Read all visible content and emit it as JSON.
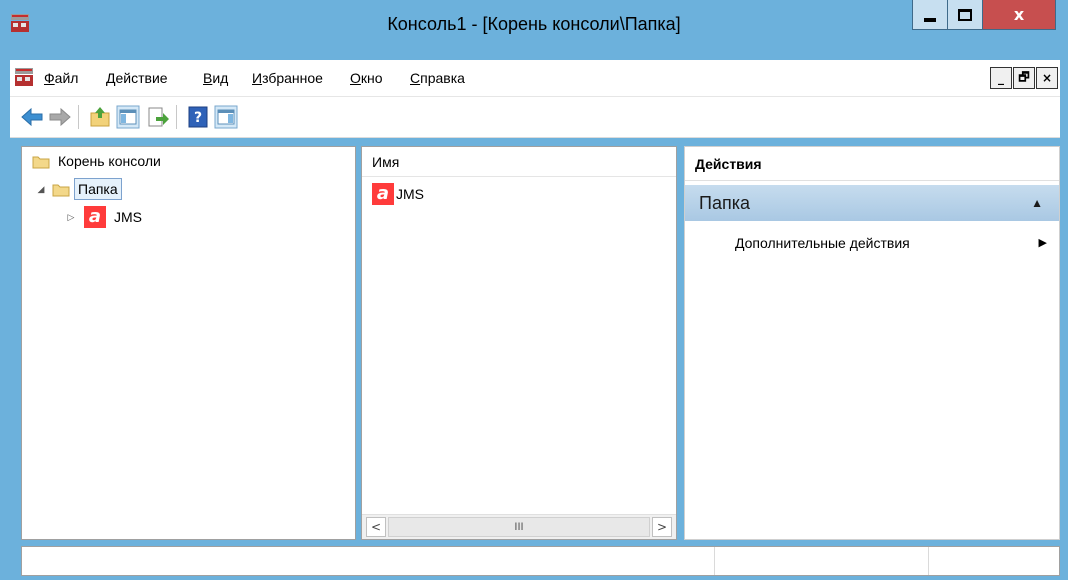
{
  "window": {
    "title": "Консоль1 - [Корень консоли\\Папка]",
    "close_glyph": "x",
    "accent_color": "#6cb1dc",
    "close_color": "#c74f4f"
  },
  "menu": {
    "items": [
      "Файл",
      "Действие",
      "Вид",
      "Избранное",
      "Окно",
      "Справка"
    ],
    "underline": [
      "Ф",
      "Д",
      "В",
      "И",
      "О",
      "С"
    ],
    "rest": [
      "айл",
      "ействие",
      "ид",
      "збранное",
      "кно",
      "правка"
    ],
    "mdi_min": "_",
    "mdi_restore": "🗗",
    "mdi_close": "×"
  },
  "toolbar": {
    "icons": [
      "back-arrow-icon",
      "forward-arrow-icon",
      "up-one-level-icon",
      "show-hide-console-tree-icon",
      "export-list-icon",
      "help-icon",
      "show-hide-action-pane-icon"
    ]
  },
  "tree": {
    "root_label": "Корень консоли",
    "folder_label": "Папка",
    "child_label": "JMS",
    "expanded_glyph": "◢",
    "collapsed_glyph": "▷",
    "jms_letter": "a"
  },
  "list": {
    "column_name": "Имя",
    "items": [
      {
        "label": "JMS",
        "icon": "jms-icon"
      }
    ],
    "scroll_left": "<",
    "scroll_right": ">",
    "scroll_thumb": "III"
  },
  "actions": {
    "header": "Действия",
    "section_title": "Папка",
    "section_arrow": "▲",
    "items": [
      {
        "label": "Дополнительные действия",
        "arrow": "▶"
      }
    ]
  }
}
